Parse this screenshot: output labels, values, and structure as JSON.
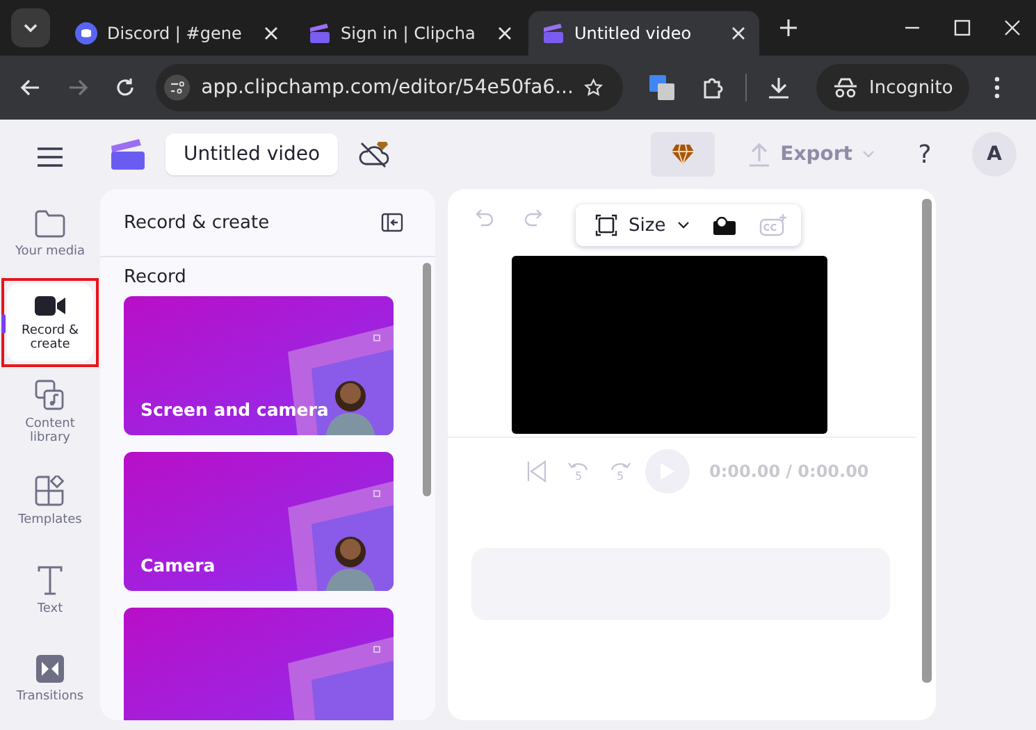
{
  "browser": {
    "tabs": [
      {
        "title": "Discord | #gene",
        "selected": false
      },
      {
        "title": "Sign in | Clipcha",
        "selected": false
      },
      {
        "title": "Untitled video",
        "selected": true
      }
    ],
    "url": "app.clipchamp.com/editor/54e50fa6...",
    "incognito": "Incognito"
  },
  "app": {
    "project_title": "Untitled video",
    "export": "Export",
    "help": "?",
    "avatar": "A"
  },
  "nav": [
    {
      "label": "Your media",
      "selected": false,
      "highlighted": false
    },
    {
      "label": "Record & create",
      "selected": true,
      "highlighted": true
    },
    {
      "label": "Content library",
      "selected": false,
      "highlighted": false
    },
    {
      "label": "Templates",
      "selected": false,
      "highlighted": false
    },
    {
      "label": "Text",
      "selected": false,
      "highlighted": false
    },
    {
      "label": "Transitions",
      "selected": false,
      "highlighted": false
    }
  ],
  "panel": {
    "title": "Record & create",
    "section": "Record",
    "cards": [
      {
        "title": "Screen and camera",
        "kind": "picture"
      },
      {
        "title": "Camera",
        "kind": "picture"
      },
      {
        "kind": "picture"
      }
    ]
  },
  "preview": {
    "size": "Size",
    "rewind": "5",
    "forward": "5",
    "time": "0:00.00",
    "duration": "/ 0:00.00"
  }
}
